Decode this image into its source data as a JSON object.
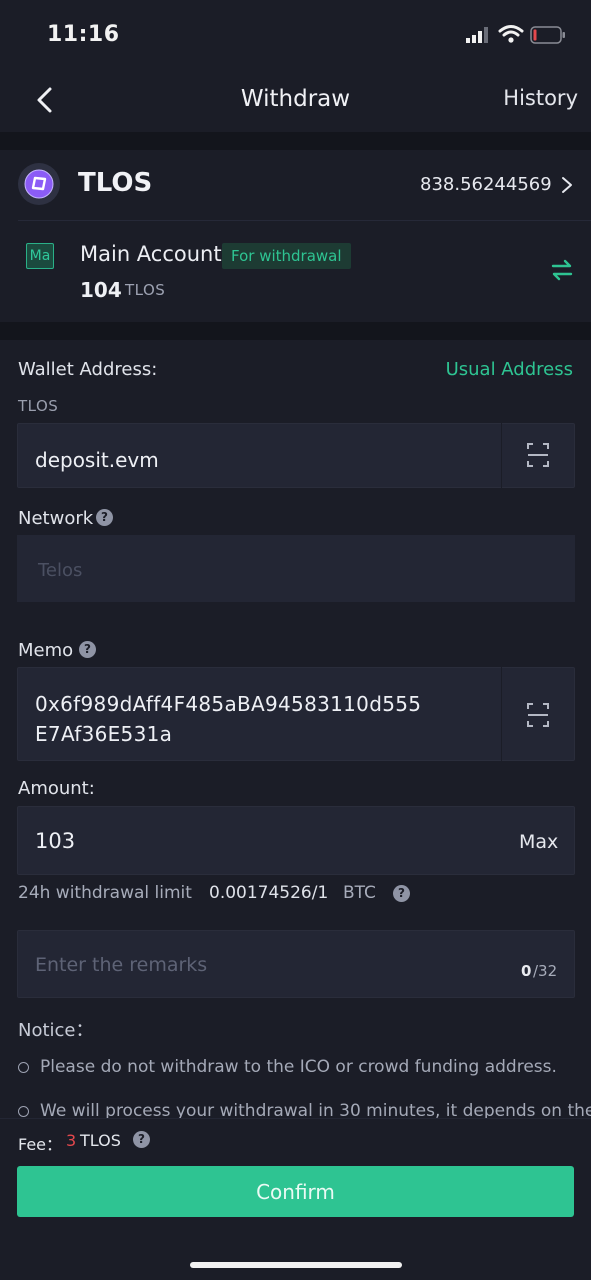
{
  "status_bar": {
    "time": "11:16"
  },
  "header": {
    "title": "Withdraw",
    "history_label": "History"
  },
  "token": {
    "symbol": "TLOS",
    "balance": "838.56244569"
  },
  "account": {
    "badge": "Ma",
    "name": "Main Account",
    "tag": "For withdrawal",
    "amount": "104",
    "unit": "TLOS"
  },
  "wallet": {
    "label": "Wallet Address:",
    "usual_address_label": "Usual Address",
    "coin": "TLOS",
    "address": "deposit.evm"
  },
  "network": {
    "label": "Network",
    "value": "Telos"
  },
  "memo": {
    "label": "Memo",
    "line1": "0x6f989dAff4F485aBA94583110d555",
    "line2": "E7Af36E531a"
  },
  "amount": {
    "label": "Amount:",
    "value": "103",
    "max_label": "Max"
  },
  "limit": {
    "label": "24h withdrawal limit",
    "value": "0.00174526/1",
    "unit": "BTC"
  },
  "remarks": {
    "placeholder": "Enter the remarks",
    "count": "0",
    "max": "/32"
  },
  "notice": {
    "title": "Notice：",
    "items": [
      "Please do not withdraw to the ICO or crowd funding address.",
      "We will process your withdrawal in 30 minutes, it depends on the"
    ]
  },
  "fee": {
    "label": "Fee：",
    "amount": "3",
    "unit": "TLOS"
  },
  "confirm_label": "Confirm",
  "help_glyph": "?",
  "colors": {
    "accent": "#2ec492",
    "fee": "#e5484d",
    "background": "#1b1d27"
  },
  "icons": {
    "back": "chevron-left-icon",
    "token": "telos-logo-icon",
    "scan": "scan-icon",
    "swap": "swap-arrows-icon",
    "help": "help-icon"
  }
}
